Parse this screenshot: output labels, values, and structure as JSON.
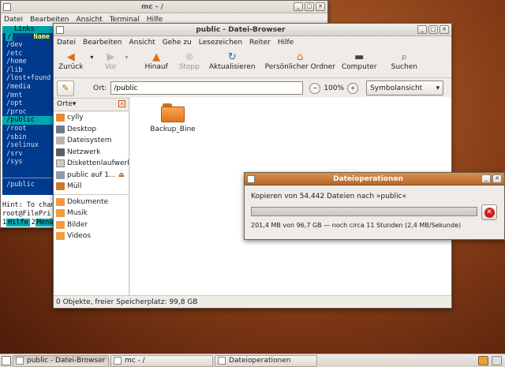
{
  "mc": {
    "title": "mc - /",
    "menu": [
      "Datei",
      "Bearbeiten",
      "Ansicht",
      "Terminal",
      "Hilfe"
    ],
    "panel_title": "Links",
    "panel_path": "/",
    "column_header": "Name",
    "rows": [
      "/dev",
      "/etc",
      "/home",
      "/lib",
      "/lost+found",
      "/media",
      "/mnt",
      "/opt",
      "/proc",
      "/public",
      "/root",
      "/sbin",
      "/selinux",
      "/srv",
      "/sys"
    ],
    "selected_row": "/public",
    "current_path": "/public",
    "hint": "Hint: To chan",
    "prompt": "root@FilePri",
    "fkeys": [
      {
        "n": "1",
        "l": "Hilfe"
      },
      {
        "n": "2",
        "l": "Menü"
      }
    ]
  },
  "fb": {
    "title": "public - Datei-Browser",
    "menu": [
      "Datei",
      "Bearbeiten",
      "Ansicht",
      "Gehe zu",
      "Lesezeichen",
      "Reiter",
      "Hilfe"
    ],
    "toolbar": {
      "back": "Zurück",
      "forward": "Vor",
      "up": "Hinauf",
      "stop": "Stopp",
      "reload": "Aktualisieren",
      "home": "Persönlicher Ordner",
      "computer": "Computer",
      "search": "Suchen"
    },
    "location_label": "Ort:",
    "location_value": "/public",
    "zoom": "100%",
    "view_mode": "Symbolansicht",
    "side_header": "Orte",
    "places": [
      "cylly",
      "Desktop",
      "Dateisystem",
      "Netzwerk",
      "Diskettenlaufwerk",
      "public auf 1...",
      "Müll"
    ],
    "bookmarks": [
      "Dokumente",
      "Musik",
      "Bilder",
      "Videos"
    ],
    "files": [
      {
        "name": "Backup_Bine"
      }
    ],
    "status": "0 Objekte, freier Speicherplatz: 99,8 GB"
  },
  "dialog": {
    "title": "Dateioperationen",
    "message": "Kopieren von 54.442 Dateien nach »public«",
    "progress": 0.0,
    "detail": "201,4 MB von 96,7 GB — noch circa 11 Stunden (2,4 MB/Sekunde)"
  },
  "taskbar": {
    "tasks": [
      "public - Datei-Browser",
      "mc - /",
      "Dateioperationen"
    ]
  },
  "colors": {
    "accent": "#d9914e",
    "folder": "#f39a3f",
    "mc_panel": "#003a8c",
    "mc_selection": "#00a8b0"
  }
}
